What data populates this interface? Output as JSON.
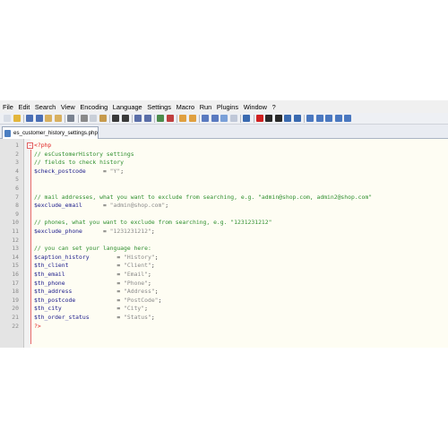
{
  "menu": [
    "File",
    "Edit",
    "Search",
    "View",
    "Encoding",
    "Language",
    "Settings",
    "Macro",
    "Run",
    "Plugins",
    "Window",
    "?"
  ],
  "toolbar_icons": [
    {
      "name": "new-file-icon",
      "color": "#d8dde6"
    },
    {
      "name": "open-file-icon",
      "color": "#e3b63c"
    },
    {
      "name": "save-icon",
      "color": "#4b6fb5"
    },
    {
      "name": "save-all-icon",
      "color": "#4b6fb5"
    },
    {
      "name": "close-icon",
      "color": "#d8b060"
    },
    {
      "name": "close-all-icon",
      "color": "#d8b060"
    },
    {
      "name": "print-icon",
      "color": "#7a8290"
    },
    {
      "name": "cut-icon",
      "color": "#8a8a8a"
    },
    {
      "name": "copy-icon",
      "color": "#c9cfd8"
    },
    {
      "name": "paste-icon",
      "color": "#c69a4c"
    },
    {
      "name": "undo-icon",
      "color": "#3a3a3a"
    },
    {
      "name": "redo-icon",
      "color": "#3a3a3a"
    },
    {
      "name": "find-icon",
      "color": "#5a6ea8"
    },
    {
      "name": "replace-icon",
      "color": "#5a6ea8"
    },
    {
      "name": "zoom-in-icon",
      "color": "#4c8c4c"
    },
    {
      "name": "zoom-out-icon",
      "color": "#c04040"
    },
    {
      "name": "sync-vertical-icon",
      "color": "#e0a040"
    },
    {
      "name": "sync-horizontal-icon",
      "color": "#e0a040"
    },
    {
      "name": "word-wrap-icon",
      "color": "#5a7ac0"
    },
    {
      "name": "show-all-chars-icon",
      "color": "#5a7ac0"
    },
    {
      "name": "indent-guide-icon",
      "color": "#7aa0d8"
    },
    {
      "name": "user-lang-icon",
      "color": "#c0c8d8"
    },
    {
      "name": "doc-map-icon",
      "color": "#3a6ab0"
    },
    {
      "name": "record-macro-icon",
      "color": "#d02020"
    },
    {
      "name": "stop-macro-icon",
      "color": "#2a2a2a"
    },
    {
      "name": "play-macro-icon",
      "color": "#2a2a2a"
    },
    {
      "name": "run-macro-multiple-icon",
      "color": "#3a6ab0"
    },
    {
      "name": "save-macro-icon",
      "color": "#3a6ab0"
    },
    {
      "name": "plugin-a-icon",
      "color": "#4a78c0"
    },
    {
      "name": "plugin-b-icon",
      "color": "#4a78c0"
    },
    {
      "name": "plugin-c-icon",
      "color": "#4a78c0"
    },
    {
      "name": "plugin-d-icon",
      "color": "#4a78c0"
    },
    {
      "name": "plugin-e-icon",
      "color": "#4a78c0"
    }
  ],
  "tab": {
    "label": "es_customer_history_settings.php"
  },
  "lines": [
    {
      "n": "1",
      "segs": [
        {
          "t": "<?php",
          "c": "k-phptag"
        }
      ]
    },
    {
      "n": "2",
      "segs": [
        {
          "t": "// esCustomerHistory settings",
          "c": "k-comment"
        }
      ]
    },
    {
      "n": "3",
      "segs": [
        {
          "t": "// fields to check history",
          "c": "k-comment"
        }
      ]
    },
    {
      "n": "4",
      "segs": [
        {
          "t": "$check_postcode",
          "c": "k-var"
        },
        {
          "t": "     = ",
          "c": "k-op"
        },
        {
          "t": "\"Y\"",
          "c": "k-str"
        },
        {
          "t": ";",
          "c": "k-op"
        }
      ]
    },
    {
      "n": "5",
      "segs": []
    },
    {
      "n": "6",
      "segs": []
    },
    {
      "n": "7",
      "segs": [
        {
          "t": "// mail addresses, what you want to exclude from searching, e.g. \"admin@shop.com, admin2@shop.com\"",
          "c": "k-comment"
        }
      ]
    },
    {
      "n": "8",
      "segs": [
        {
          "t": "$exclude_email",
          "c": "k-var"
        },
        {
          "t": "      = ",
          "c": "k-op"
        },
        {
          "t": "\"admin@shop.com\"",
          "c": "k-str"
        },
        {
          "t": ";",
          "c": "k-op"
        }
      ]
    },
    {
      "n": "9",
      "segs": []
    },
    {
      "n": "10",
      "segs": [
        {
          "t": "// phones, what you want to exclude from searching, e.g. \"1231231212\"",
          "c": "k-comment"
        }
      ]
    },
    {
      "n": "11",
      "segs": [
        {
          "t": "$exclude_phone",
          "c": "k-var"
        },
        {
          "t": "      = ",
          "c": "k-op"
        },
        {
          "t": "\"1231231212\"",
          "c": "k-str"
        },
        {
          "t": ";",
          "c": "k-op"
        }
      ]
    },
    {
      "n": "12",
      "segs": []
    },
    {
      "n": "13",
      "segs": [
        {
          "t": "// you can set your language here:",
          "c": "k-comment"
        }
      ]
    },
    {
      "n": "14",
      "segs": [
        {
          "t": "$caption_history",
          "c": "k-var"
        },
        {
          "t": "        = ",
          "c": "k-op"
        },
        {
          "t": "\"History\"",
          "c": "k-str"
        },
        {
          "t": ";",
          "c": "k-op"
        }
      ]
    },
    {
      "n": "15",
      "segs": [
        {
          "t": "$th_client",
          "c": "k-var"
        },
        {
          "t": "              = ",
          "c": "k-op"
        },
        {
          "t": "\"Client\"",
          "c": "k-str"
        },
        {
          "t": ";",
          "c": "k-op"
        }
      ]
    },
    {
      "n": "16",
      "segs": [
        {
          "t": "$th_email",
          "c": "k-var"
        },
        {
          "t": "               = ",
          "c": "k-op"
        },
        {
          "t": "\"Email\"",
          "c": "k-str"
        },
        {
          "t": ";",
          "c": "k-op"
        }
      ]
    },
    {
      "n": "17",
      "segs": [
        {
          "t": "$th_phone",
          "c": "k-var"
        },
        {
          "t": "               = ",
          "c": "k-op"
        },
        {
          "t": "\"Phone\"",
          "c": "k-str"
        },
        {
          "t": ";",
          "c": "k-op"
        }
      ]
    },
    {
      "n": "18",
      "segs": [
        {
          "t": "$th_address",
          "c": "k-var"
        },
        {
          "t": "             = ",
          "c": "k-op"
        },
        {
          "t": "\"Address\"",
          "c": "k-str"
        },
        {
          "t": ";",
          "c": "k-op"
        }
      ]
    },
    {
      "n": "19",
      "segs": [
        {
          "t": "$th_postcode",
          "c": "k-var"
        },
        {
          "t": "            = ",
          "c": "k-op"
        },
        {
          "t": "\"PostCode\"",
          "c": "k-str"
        },
        {
          "t": ";",
          "c": "k-op"
        }
      ]
    },
    {
      "n": "20",
      "segs": [
        {
          "t": "$th_city",
          "c": "k-var"
        },
        {
          "t": "                = ",
          "c": "k-op"
        },
        {
          "t": "\"City\"",
          "c": "k-str"
        },
        {
          "t": ";",
          "c": "k-op"
        }
      ]
    },
    {
      "n": "21",
      "segs": [
        {
          "t": "$th_order_status",
          "c": "k-var"
        },
        {
          "t": "        = ",
          "c": "k-op"
        },
        {
          "t": "\"Status\"",
          "c": "k-str"
        },
        {
          "t": ";",
          "c": "k-op"
        }
      ]
    },
    {
      "n": "22",
      "segs": [
        {
          "t": "?>",
          "c": "k-phptag"
        }
      ]
    }
  ]
}
